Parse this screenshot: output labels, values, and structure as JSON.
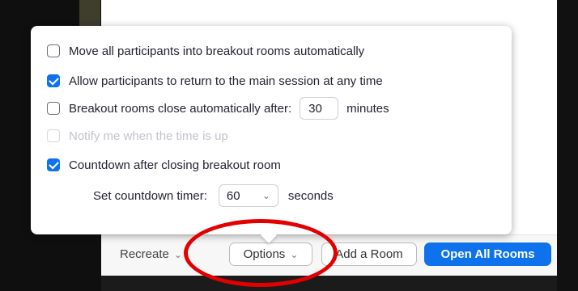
{
  "options": [
    {
      "label": "Move all participants into breakout rooms automatically",
      "checked": false,
      "disabled": false
    },
    {
      "label": "Allow participants to return to the main session at any time",
      "checked": true,
      "disabled": false
    },
    {
      "label": "Breakout rooms close automatically after:",
      "checked": false,
      "disabled": false,
      "input_value": "30",
      "suffix": "minutes"
    },
    {
      "label": "Notify me when the time is up",
      "checked": false,
      "disabled": true
    },
    {
      "label": "Countdown after closing breakout room",
      "checked": true,
      "disabled": false
    }
  ],
  "countdown": {
    "label": "Set countdown timer:",
    "value": "60",
    "suffix": "seconds"
  },
  "bottom_bar": {
    "recreate_label": "Recreate",
    "options_label": "Options",
    "add_room_label": "Add a Room",
    "open_all_label": "Open All Rooms"
  },
  "colors": {
    "accent": "#0e72ed",
    "highlight": "#e30000"
  },
  "icons": {
    "chevron": "chevron-down-icon",
    "checkbox_check": "check-icon"
  }
}
